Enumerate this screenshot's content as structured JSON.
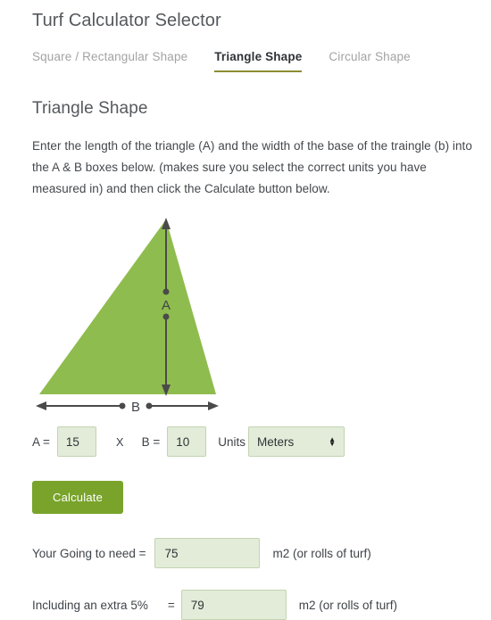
{
  "header": {
    "title": "Turf Calculator Selector"
  },
  "tabs": [
    {
      "label": "Square / Rectangular Shape",
      "active": false
    },
    {
      "label": "Triangle Shape",
      "active": true
    },
    {
      "label": "Circular Shape",
      "active": false
    }
  ],
  "section": {
    "title": "Triangle Shape",
    "description": "Enter the length of the triangle (A) and the width of the base of the traingle (b) into the A & B boxes below.  (makes sure you select the correct units you have measured in) and then click the Calculate button below."
  },
  "diagram": {
    "shape": "triangle",
    "fill_color": "#8fbc4e",
    "line_color": "#4a4a4a",
    "height_label": "A",
    "base_label": "B"
  },
  "form": {
    "a_label": "A =",
    "a_value": "15",
    "a_placeholder": "",
    "multiply_symbol": "X",
    "b_label": "B =",
    "b_value": "10",
    "b_placeholder": "",
    "units_label": "Units",
    "units_selected": "Meters",
    "units_options": [
      "Meters"
    ],
    "calculate_label": "Calculate"
  },
  "results": [
    {
      "label": "Your Going to need =",
      "value": "75",
      "suffix": "m2 (or rolls of turf)"
    },
    {
      "label": "Including an extra 5%",
      "equals": "=",
      "value": "79",
      "suffix": "m2 (or rolls of turf)"
    }
  ],
  "colors": {
    "accent_green": "#79a32b",
    "triangle_green": "#8fbc4e",
    "field_bg": "#e3ecd9",
    "field_border": "#c2d4b0",
    "tab_underline": "#8c8c33"
  }
}
